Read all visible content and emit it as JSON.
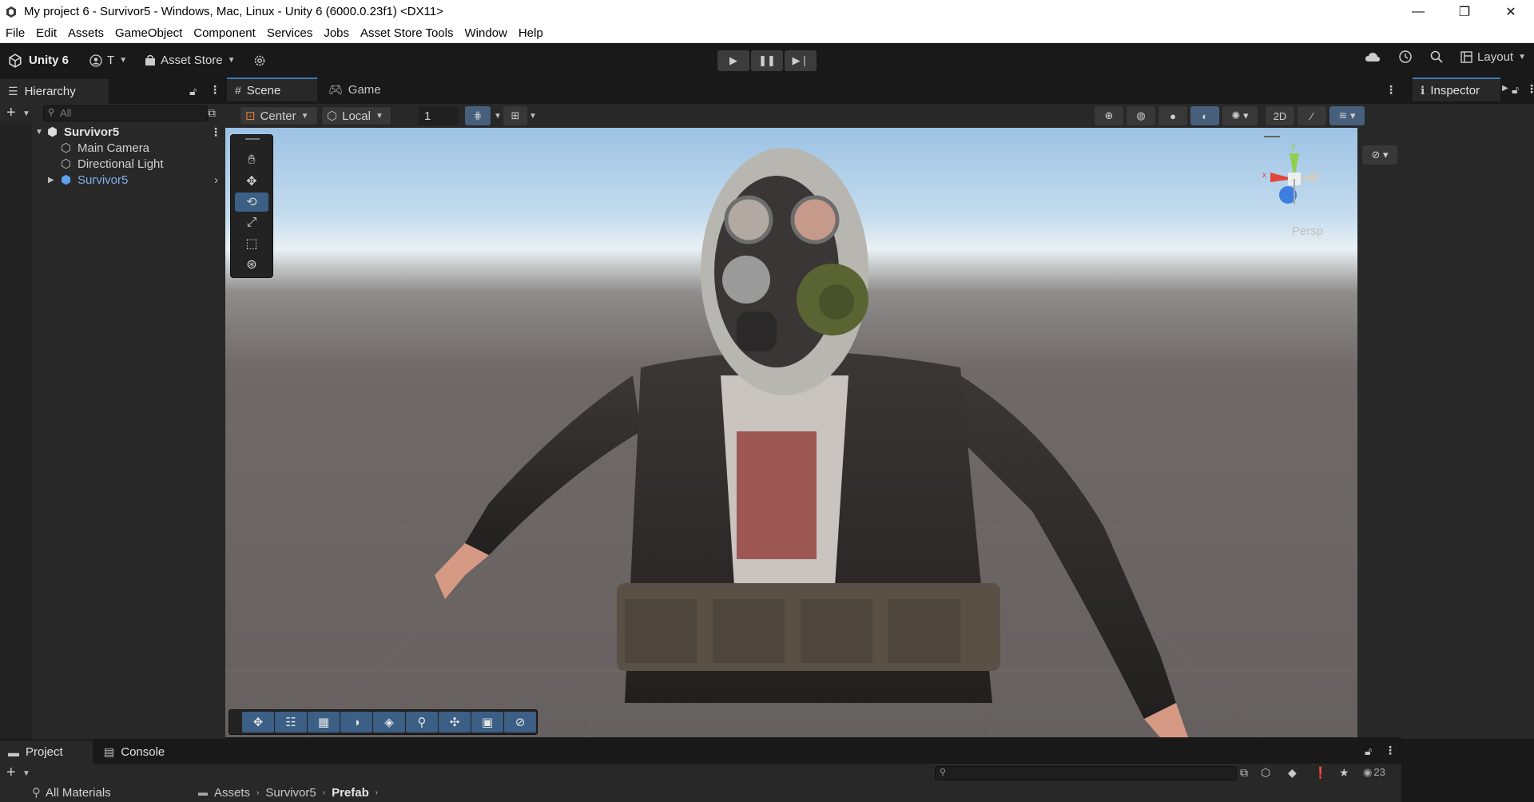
{
  "window": {
    "title": "My project 6 - Survivor5 - Windows, Mac, Linux - Unity 6 (6000.0.23f1) <DX11>",
    "minimize": "—",
    "restore": "❐",
    "close": "✕"
  },
  "menu": [
    "File",
    "Edit",
    "Assets",
    "GameObject",
    "Component",
    "Services",
    "Jobs",
    "Asset Store Tools",
    "Window",
    "Help"
  ],
  "toolbar": {
    "unity_label": "Unity 6",
    "account_label": "T",
    "asset_store_label": "Asset Store",
    "layout_label": "Layout"
  },
  "hierarchy": {
    "tab_label": "Hierarchy",
    "search_placeholder": "All",
    "scene_name": "Survivor5",
    "items": [
      {
        "label": "Main Camera",
        "color": "#d2d2d2"
      },
      {
        "label": "Directional Light",
        "color": "#d2d2d2"
      },
      {
        "label": "Survivor5",
        "color": "#7fb1e8"
      }
    ]
  },
  "scene": {
    "tabs": [
      "Scene",
      "Game"
    ],
    "pivot_mode": "Center",
    "pivot_rotation": "Local",
    "grid_value": "1",
    "camera_mode": "Persp"
  },
  "inspector": {
    "tab_label": "Inspector"
  },
  "project": {
    "tabs": [
      "Project",
      "Console"
    ],
    "favorites_item": "All Materials",
    "breadcrumb": [
      "Assets",
      "Survivor5",
      "Prefab"
    ],
    "hidden_count": "23"
  },
  "colors": {
    "accent": "#3a79bb",
    "tool_active": "#3b5f85",
    "prefab_blue": "#7fb1e8"
  }
}
